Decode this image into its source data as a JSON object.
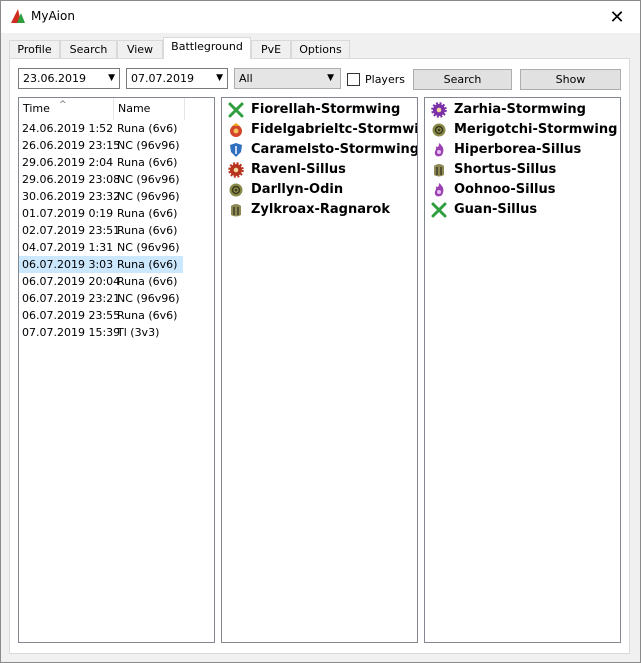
{
  "window": {
    "title": "MyAion",
    "close_glyph": "✕"
  },
  "tabs": [
    {
      "label": "Profile",
      "active": false
    },
    {
      "label": "Search",
      "active": false
    },
    {
      "label": "View",
      "active": false
    },
    {
      "label": "Battleground",
      "active": true
    },
    {
      "label": "PvE",
      "active": false
    },
    {
      "label": "Options",
      "active": false
    }
  ],
  "filters": {
    "date_from": "23.06.2019",
    "date_to": "07.07.2019",
    "type_select": "All",
    "players_checkbox_label": "Players",
    "players_checked": false,
    "search_button": "Search",
    "show_button": "Show"
  },
  "battle_list": {
    "columns": [
      "Time",
      "Name"
    ],
    "sort_indicator": "^",
    "rows": [
      {
        "time": "24.06.2019 1:52",
        "name": "Runa (6v6)"
      },
      {
        "time": "26.06.2019 23:15",
        "name": "NC (96v96)"
      },
      {
        "time": "29.06.2019 2:04",
        "name": "Runa (6v6)"
      },
      {
        "time": "29.06.2019 23:08",
        "name": "NC (96v96)"
      },
      {
        "time": "30.06.2019 23:32",
        "name": "NC (96v96)"
      },
      {
        "time": "01.07.2019 0:19",
        "name": "Runa (6v6)"
      },
      {
        "time": "02.07.2019 23:51",
        "name": "Runa (6v6)"
      },
      {
        "time": "04.07.2019 1:31",
        "name": "NC (96v96)"
      },
      {
        "time": "06.07.2019 3:03",
        "name": "Runa (6v6)"
      },
      {
        "time": "06.07.2019 20:04",
        "name": "Runa (6v6)"
      },
      {
        "time": "06.07.2019 23:21",
        "name": "NC (96v96)"
      },
      {
        "time": "06.07.2019 23:55",
        "name": "Runa (6v6)"
      },
      {
        "time": "07.07.2019 15:39",
        "name": "Tl (3v3)"
      }
    ],
    "selected_index": 8
  },
  "team1": [
    {
      "name": "Fiorellah-Stormwing",
      "icon": "green-crossed-swords-icon",
      "color": "#2e9e3e"
    },
    {
      "name": "Fidelgabrieltc-Stormwing",
      "icon": "red-orange-emblem-icon",
      "color": "#d2452a"
    },
    {
      "name": "Caramelsto-Stormwing",
      "icon": "blue-shield-icon",
      "color": "#2f6fc0"
    },
    {
      "name": "Ravenl-Sillus",
      "icon": "red-gear-icon",
      "color": "#b8331e"
    },
    {
      "name": "Darllyn-Odin",
      "icon": "olive-circle-icon",
      "color": "#8a8a4a"
    },
    {
      "name": "Zylkroax-Ragnarok",
      "icon": "olive-helm-icon",
      "color": "#8f8a55"
    }
  ],
  "team2": [
    {
      "name": "Zarhia-Stormwing",
      "icon": "purple-gear-icon",
      "color": "#7a2ea8"
    },
    {
      "name": "Merigotchi-Stormwing",
      "icon": "olive-circle-icon",
      "color": "#8a8a4a"
    },
    {
      "name": "Hiperborea-Sillus",
      "icon": "purple-flame-icon",
      "color": "#9b3fb3"
    },
    {
      "name": "Shortus-Sillus",
      "icon": "olive-helm-icon",
      "color": "#8f8a55"
    },
    {
      "name": "Oohnoo-Sillus",
      "icon": "purple-flame-icon",
      "color": "#9b3fb3"
    },
    {
      "name": "Guan-Sillus",
      "icon": "green-crossed-swords-icon",
      "color": "#2e9e3e"
    }
  ]
}
